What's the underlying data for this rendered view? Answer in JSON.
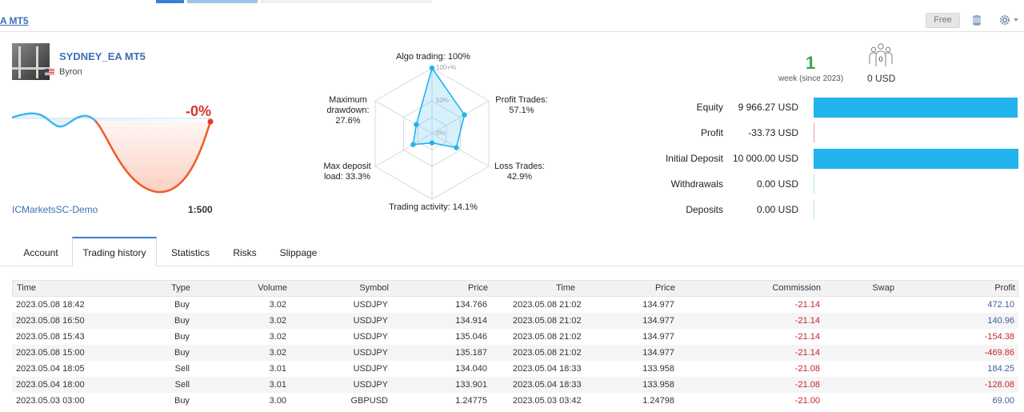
{
  "header": {
    "breadcrumb": "A MT5",
    "free_label": "Free"
  },
  "profile": {
    "name": "SYDNEY_EA MT5",
    "author": "Byron",
    "growth": "-0%",
    "broker": "ICMarketsSC-Demo",
    "leverage": "1:500"
  },
  "radar": {
    "algo_trading": "Algo trading: 100%",
    "profit_trades_label": "Profit Trades:",
    "profit_trades_value": "57.1%",
    "loss_trades_label": "Loss Trades:",
    "loss_trades_value": "42.9%",
    "trading_activity": "Trading activity: 14.1%",
    "max_deposit_label": "Max deposit",
    "max_deposit_value": "load: 33.3%",
    "max_drawdown_label1": "Maximum",
    "max_drawdown_label2": "drawdown:",
    "max_drawdown_value": "27.6%",
    "tick_100": "100+%",
    "tick_50": "50%",
    "tick_0": "0%",
    "values": {
      "algo_trading": 1.0,
      "profit_trades": 0.571,
      "loss_trades": 0.429,
      "trading_activity": 0.141,
      "max_deposit_load": 0.333,
      "max_drawdown": 0.276
    }
  },
  "age": {
    "value": "1",
    "label": "week (since 2023)"
  },
  "subscribers": {
    "count": "0",
    "price": "0 USD"
  },
  "metrics": [
    {
      "label": "Equity",
      "value": "9 966.27 USD",
      "fill": 0.997
    },
    {
      "label": "Profit",
      "value": "-33.73 USD",
      "fill": 0.003
    },
    {
      "label": "Initial Deposit",
      "value": "10 000.00 USD",
      "fill": 1.0
    },
    {
      "label": "Withdrawals",
      "value": "0.00 USD",
      "fill": 0
    },
    {
      "label": "Deposits",
      "value": "0.00 USD",
      "fill": 0
    }
  ],
  "tabs": [
    "Account",
    "Trading history",
    "Statistics",
    "Risks",
    "Slippage"
  ],
  "table": {
    "headers": [
      "Time",
      "Type",
      "Volume",
      "Symbol",
      "Price",
      "Time",
      "Price",
      "Commission",
      "Swap",
      "Profit"
    ],
    "rows": [
      [
        "2023.05.08 18:42",
        "Buy",
        "3.02",
        "USDJPY",
        "134.766",
        "2023.05.08 21:02",
        "134.977",
        "-21.14",
        "",
        "472.10"
      ],
      [
        "2023.05.08 16:50",
        "Buy",
        "3.02",
        "USDJPY",
        "134.914",
        "2023.05.08 21:02",
        "134.977",
        "-21.14",
        "",
        "140.96"
      ],
      [
        "2023.05.08 15:43",
        "Buy",
        "3.02",
        "USDJPY",
        "135.046",
        "2023.05.08 21:02",
        "134.977",
        "-21.14",
        "",
        "-154.38"
      ],
      [
        "2023.05.08 15:00",
        "Buy",
        "3.02",
        "USDJPY",
        "135.187",
        "2023.05.08 21:02",
        "134.977",
        "-21.14",
        "",
        "-469.86"
      ],
      [
        "2023.05.04 18:05",
        "Sell",
        "3.01",
        "USDJPY",
        "134.040",
        "2023.05.04 18:33",
        "133.958",
        "-21.08",
        "",
        "184.25"
      ],
      [
        "2023.05.04 18:00",
        "Sell",
        "3.01",
        "USDJPY",
        "133.901",
        "2023.05.04 18:33",
        "133.958",
        "-21.08",
        "",
        "-128.08"
      ],
      [
        "2023.05.03 03:00",
        "Buy",
        "3.00",
        "GBPUSD",
        "1.24775",
        "2023.05.03 03:42",
        "1.24798",
        "-21.00",
        "",
        "69.00"
      ]
    ]
  },
  "colors": {
    "accent": "#3b7dd8",
    "bar": "#21b4ec",
    "negative": "#c7242b",
    "positive": "#3e5aa5",
    "age": "#35a84a",
    "growth_line": "#f05a28"
  }
}
